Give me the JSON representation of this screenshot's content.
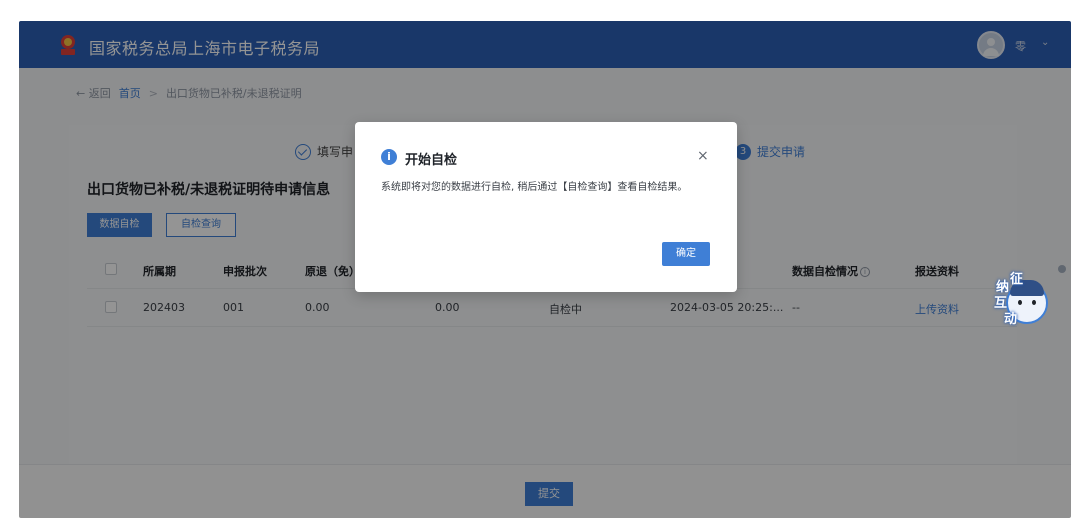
{
  "header": {
    "app_title": "国家税务总局上海市电子税务局",
    "user_name": "零",
    "user_caret": "⌄"
  },
  "breadcrumb": {
    "back": "← 返回",
    "home": "首页",
    "separator": ">",
    "current": "出口货物已补税/未退税证明"
  },
  "steps": {
    "step1_label": "填写申",
    "step3_number": "3",
    "step3_label": "提交申请"
  },
  "main": {
    "section_title": "出口货物已补税/未退税证明待申请信息",
    "btn_data_check": "数据自检",
    "btn_check_query": "自检查询"
  },
  "table": {
    "headers": [
      "所属期",
      "申报批次",
      "原退（免）",
      "",
      "",
      "",
      "数据自检情况",
      "报送资料"
    ],
    "info_glyph": "i",
    "rows": [
      [
        "202403",
        "001",
        "0.00",
        "0.00",
        "自检中",
        "2024-03-05 20:25:...",
        "--",
        "上传资料"
      ]
    ]
  },
  "footer": {
    "submit": "提交"
  },
  "modal": {
    "icon": "i",
    "title": "开始自检",
    "close": "×",
    "body": "系统即将对您的数据进行自检, 稍后通过【自检查询】查看自检结果。",
    "ok": "确定"
  },
  "widget": {
    "chars": [
      "征",
      "纳",
      "互",
      "动"
    ]
  },
  "colors": {
    "primary": "#3f7fd6",
    "header": "#2b5fb5"
  }
}
